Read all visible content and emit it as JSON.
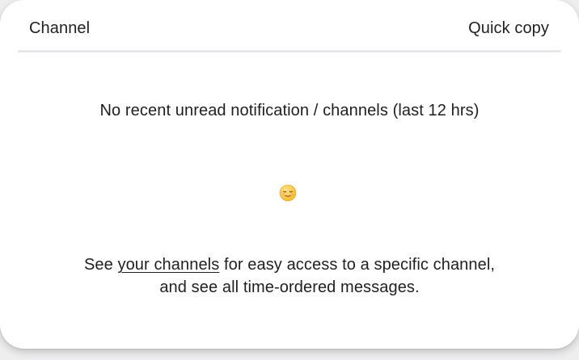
{
  "header": {
    "left_label": "Channel",
    "right_label": "Quick copy"
  },
  "empty_state": {
    "title": "No recent unread notification / channels (last 12 hrs)",
    "emoji_icon": "relieved-face-emoji",
    "footer_prefix": "See ",
    "footer_link": "your channels",
    "footer_suffix": " for easy access to a specific channel,",
    "footer_line2": "and see all time-ordered messages."
  },
  "colors": {
    "background": "#eeeeef",
    "card": "#ffffff",
    "divider": "#e6e7ea",
    "text": "#1f1f1f",
    "emoji": "#f5c342"
  }
}
